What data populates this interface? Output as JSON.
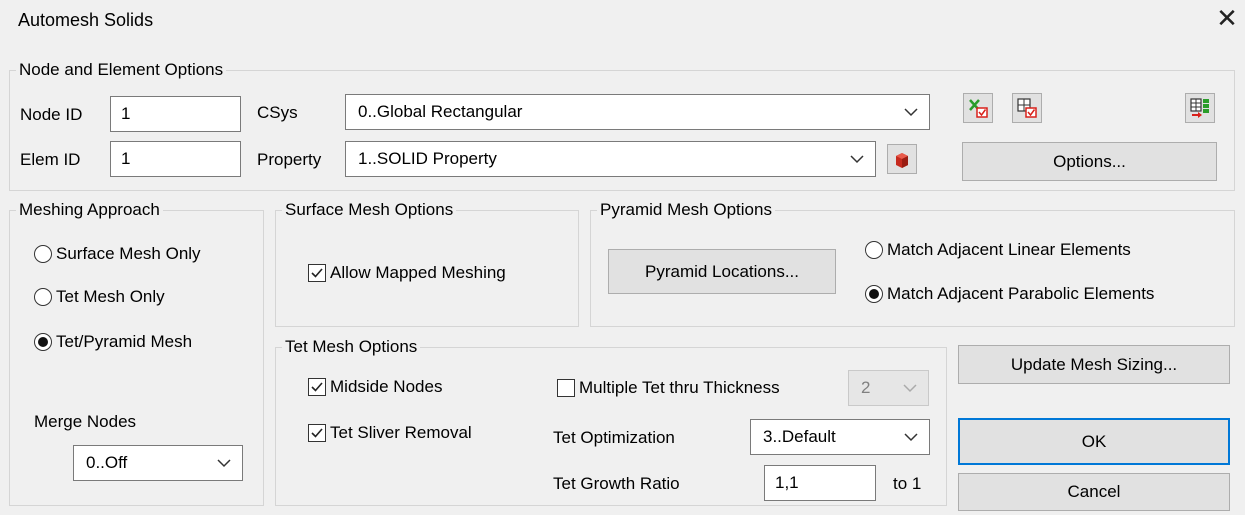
{
  "window": {
    "title": "Automesh Solids"
  },
  "node_element": {
    "legend": "Node and Element Options",
    "node_id_label": "Node ID",
    "node_id_value": "1",
    "elem_id_label": "Elem ID",
    "elem_id_value": "1",
    "csys_label": "CSys",
    "csys_value": "0..Global Rectangular",
    "property_label": "Property",
    "property_value": "1..SOLID Property",
    "options_button": "Options..."
  },
  "meshing_approach": {
    "legend": "Meshing Approach",
    "options": [
      "Surface Mesh Only",
      "Tet Mesh Only",
      "Tet/Pyramid Mesh"
    ],
    "selected": "Tet/Pyramid Mesh",
    "merge_nodes_label": "Merge Nodes",
    "merge_nodes_value": "0..Off"
  },
  "surface_mesh": {
    "legend": "Surface Mesh Options",
    "allow_mapped_label": "Allow Mapped Meshing",
    "allow_mapped_checked": true
  },
  "pyramid_mesh": {
    "legend": "Pyramid Mesh Options",
    "locations_button": "Pyramid Locations...",
    "match_linear_label": "Match Adjacent Linear Elements",
    "match_parabolic_label": "Match Adjacent Parabolic Elements",
    "selected": "Match Adjacent Parabolic Elements"
  },
  "tet_mesh": {
    "legend": "Tet Mesh Options",
    "midside_label": "Midside Nodes",
    "midside_checked": true,
    "sliver_label": "Tet Sliver Removal",
    "sliver_checked": true,
    "multiple_label": "Multiple Tet thru Thickness",
    "multiple_checked": false,
    "multiple_value": "2",
    "optimization_label": "Tet Optimization",
    "optimization_value": "3..Default",
    "growth_label": "Tet Growth Ratio",
    "growth_value": "1,1",
    "growth_suffix": "to 1"
  },
  "actions": {
    "update_sizing": "Update Mesh Sizing...",
    "ok": "OK",
    "cancel": "Cancel"
  },
  "icons": [
    "x-check-icon",
    "grid-check-icon",
    "grid-transfer-icon",
    "solid-property-icon",
    "close-icon",
    "chevron-down-icon"
  ],
  "colors": {
    "accent": "#0078d7",
    "background": "#f0f0f0",
    "icon_red": "#d9201a",
    "icon_green": "#2a9d2a"
  }
}
